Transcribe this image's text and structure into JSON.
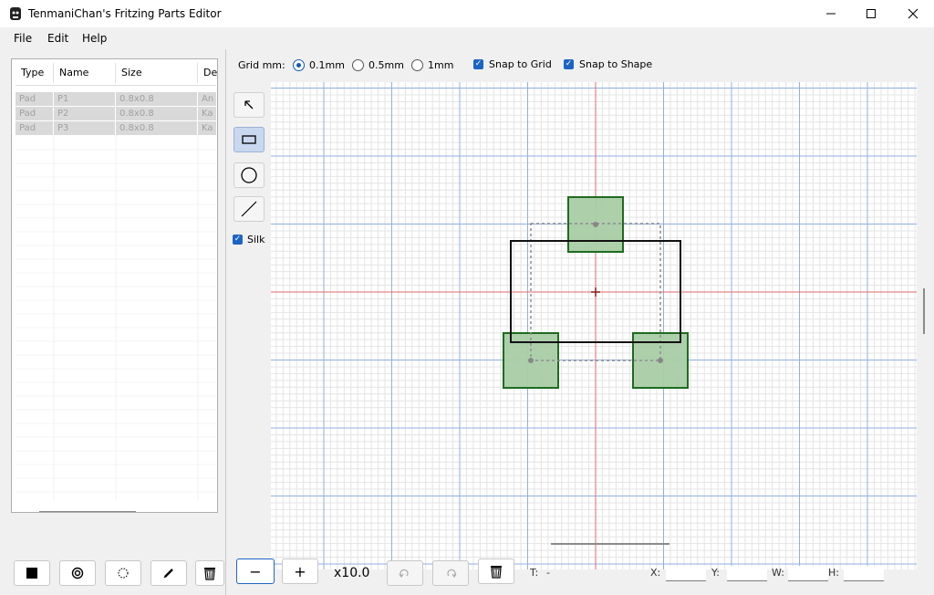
{
  "window": {
    "title": "TenmaniChan's Fritzing Parts Editor",
    "minimize_icon": "minimize-icon",
    "maximize_icon": "maximize-icon",
    "close_icon": "close-icon"
  },
  "menu": [
    "File",
    "Edit",
    "Help"
  ],
  "parts_table": {
    "columns": [
      "Type",
      "Name",
      "Size",
      "De"
    ],
    "rows": [
      [
        "Pad",
        "P1",
        "0.8x0.8",
        "An"
      ],
      [
        "Pad",
        "P2",
        "0.8x0.8",
        "Ka"
      ],
      [
        "Pad",
        "P3",
        "0.8x0.8",
        "Ka"
      ]
    ]
  },
  "grid_options": {
    "label": "Grid mm:",
    "choices": [
      "0.1mm",
      "0.5mm",
      "1mm"
    ],
    "selected": "0.1mm",
    "snap_to_grid": {
      "label": "Snap to Grid",
      "checked": true
    },
    "snap_to_shape": {
      "label": "Snap to Shape",
      "checked": true
    }
  },
  "side_tools": {
    "pointer": "arrow-pointer-icon",
    "rect": "rectangle-icon",
    "circle": "circle-icon",
    "line": "line-icon",
    "silk": {
      "label": "Silk",
      "checked": true
    }
  },
  "canvas": {
    "colors": {
      "pad_fill": "#a9cda6",
      "pad_stroke": "#1f6b1f",
      "silk": "#111111",
      "origin": "#c83232",
      "major_grid": "#8fb0e0",
      "minor_grid": "#e4e4e4"
    }
  },
  "zoom": {
    "minus": "−",
    "plus": "+",
    "level": "x10.0"
  },
  "status": {
    "t_label": "T:",
    "t_value": "-",
    "x_label": "X:",
    "y_label": "Y:",
    "w_label": "W:",
    "h_label": "H:"
  },
  "left_toolbar": [
    "fill-square-icon",
    "ring-icon",
    "dotted-circle-icon",
    "pen-icon",
    "trash-icon"
  ],
  "bottom_toolbar": [
    "undo-icon",
    "redo-icon",
    "trash-icon"
  ]
}
